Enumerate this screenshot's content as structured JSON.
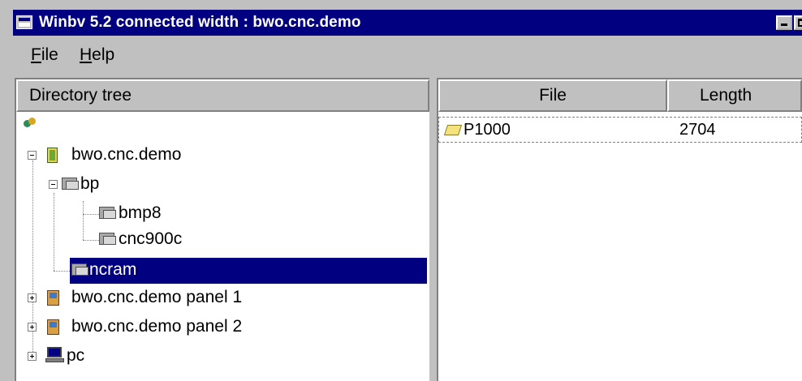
{
  "window": {
    "title": "Winbv 5.2 connected width : bwo.cnc.demo"
  },
  "menu": {
    "file_label": "ile",
    "file_accel": "F",
    "help_label": "elp",
    "help_accel": "H"
  },
  "tree": {
    "header": "Directory tree",
    "nodes": [
      {
        "label": "",
        "icon": "network-icon"
      },
      {
        "label": "bwo.cnc.demo",
        "icon": "server-icon",
        "expanded": true
      },
      {
        "label": "bp",
        "icon": "folder-icon",
        "expanded": true
      },
      {
        "label": "bmp8",
        "icon": "folder-icon"
      },
      {
        "label": "cnc900c",
        "icon": "folder-icon"
      },
      {
        "label": "ncram",
        "icon": "folder-icon",
        "selected": true
      },
      {
        "label": "bwo.cnc.demo panel 1",
        "icon": "panel-icon",
        "expanded": false
      },
      {
        "label": "bwo.cnc.demo panel 2",
        "icon": "panel-icon",
        "expanded": false
      },
      {
        "label": "pc",
        "icon": "pc-icon",
        "expanded": false
      }
    ]
  },
  "files": {
    "headers": {
      "file": "File",
      "length": "Length"
    },
    "rows": [
      {
        "name": "P1000",
        "length": "2704",
        "icon": "file-icon"
      }
    ]
  },
  "colors": {
    "titlebar": "#000080",
    "selection": "#000080",
    "face": "#c0c0c0"
  }
}
